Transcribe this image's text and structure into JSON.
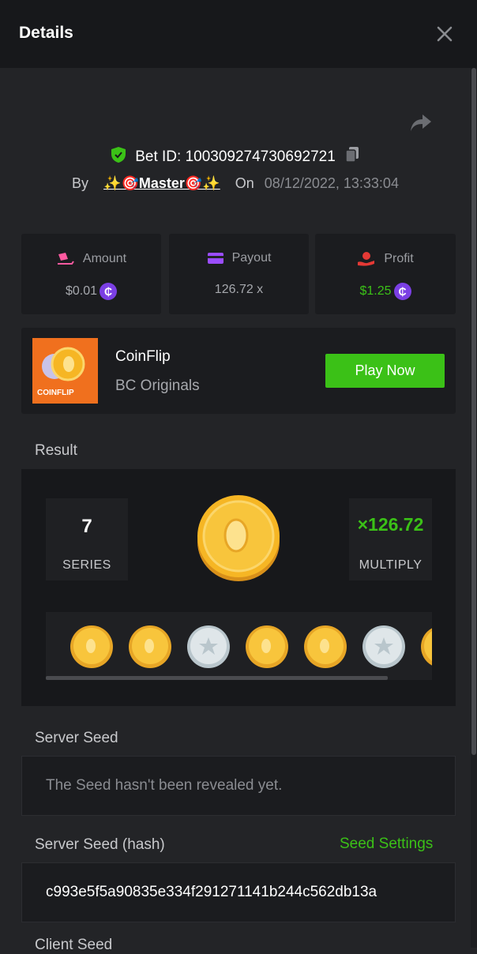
{
  "header": {
    "title": "Details"
  },
  "bet": {
    "id_text": "Bet ID: 100309274730692721",
    "by_label": "By",
    "user": "✨🎯Master🎯✨",
    "on_label": "On",
    "date": "08/12/2022, 13:33:04"
  },
  "stats": {
    "amount": {
      "label": "Amount",
      "value": "$0.01",
      "color": "#ff5aa0"
    },
    "payout": {
      "label": "Payout",
      "value": "126.72 x",
      "color": "#9b4dff"
    },
    "profit": {
      "label": "Profit",
      "value": "$1.25",
      "color": "#e53935"
    }
  },
  "currency_symbol": "₵",
  "game": {
    "thumb_text": "COINFLIP",
    "name": "CoinFlip",
    "subtitle": "BC Originals",
    "play_label": "Play Now"
  },
  "result": {
    "label": "Result",
    "series_value": "7",
    "series_label": "SERIES",
    "multiply_value": "×126.72",
    "multiply_label": "MULTIPLY",
    "coins": [
      "gold-coin",
      "gold-coin",
      "silver-coin",
      "gold-coin",
      "gold-coin",
      "silver-coin",
      "gold-coin"
    ]
  },
  "server_seed": {
    "label": "Server Seed",
    "value": "The Seed hasn't been revealed yet."
  },
  "server_seed_hash": {
    "label": "Server Seed (hash)",
    "settings_link": "Seed Settings",
    "value": "c993e5f5a90835e334f291271141b244c562db13a"
  },
  "next_label": "Client Seed",
  "colors": {
    "accent_green": "#3bc117",
    "panel": "#1b1c1f",
    "background": "#232427"
  }
}
